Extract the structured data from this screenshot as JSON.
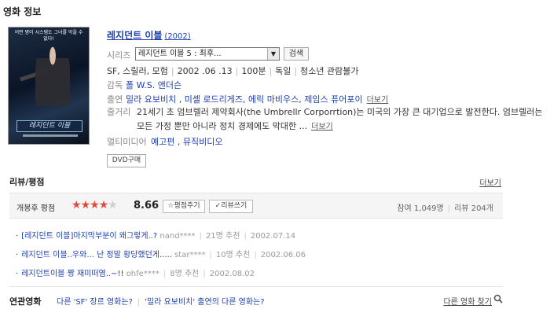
{
  "section_title": "영화 정보",
  "movie": {
    "poster_tagline": "어떤 병이 시스템도 그녀를 막을 수 없다!",
    "poster_logo": "레지던트 이블",
    "title": "레지던트 이블",
    "year": "(2002)",
    "series": {
      "label": "시리즈",
      "selected": "레지던트 이블 5 : 최후...",
      "search_button": "검색"
    },
    "genre": "SF, 스릴러, 모험",
    "release_date": "2002 .06 .13",
    "runtime": "100분",
    "country": "독일",
    "age_rating": "청소년 관람불가",
    "director_label": "감독",
    "director": "폴 W.S. 앤더슨",
    "cast_label": "출연",
    "cast": "밀라 요보비치 , 미셸 로드리게즈, 에릭 마비우스, 제임스 퓨어포이",
    "cast_more": "더보기",
    "plot_label": "줄거리",
    "plot": "21세기 초 엄브렐러 제약회사(the Umbrellr Corporrtion)는 미국의 가장 큰 대기업으로 발전한다. 엄브렐러는 모든 가정 뿐만 아니라 정치 경제에도 막대한 ...",
    "plot_more": "더보기",
    "multimedia_label": "멀티미디어",
    "multimedia": "예고편 , 뮤직비디오",
    "dvd_button": "DVD구매"
  },
  "reviews": {
    "title": "리뷰/평점",
    "more": "더보기",
    "rating_label": "개봉후 평점",
    "score": "8.66",
    "stars_filled": 4,
    "stars_total": 5,
    "rate_button": "☆평점주기",
    "write_button": "✓리뷰쓰기",
    "participants": "참여 1,049명",
    "review_count": "리뷰 204개",
    "items": [
      {
        "text": "[레지던트 이블]마지막부분이 왜그렇게..?",
        "author": "nand****",
        "recs": "21명 추천",
        "date": "2002.07.14"
      },
      {
        "text": "레지던트 이블..우와... 난 정말 황당했던게.....",
        "author": "star****",
        "recs": "10명 추천",
        "date": "2002.06.06"
      },
      {
        "text": "레지던트이블 짱 재미떠염..~!!",
        "author": "ohfe****",
        "recs": "8명 추천",
        "date": "2002.08.02"
      }
    ]
  },
  "related": {
    "title": "연관영화",
    "link1": "다른 'SF' 장르 영화는?",
    "link2": "'밀라 요보비치' 출연의 다른 영화는?",
    "more": "다른 영화 찾기"
  },
  "colors": {
    "link_blue": "#1d3fb0",
    "star_red": "#e3493b"
  }
}
